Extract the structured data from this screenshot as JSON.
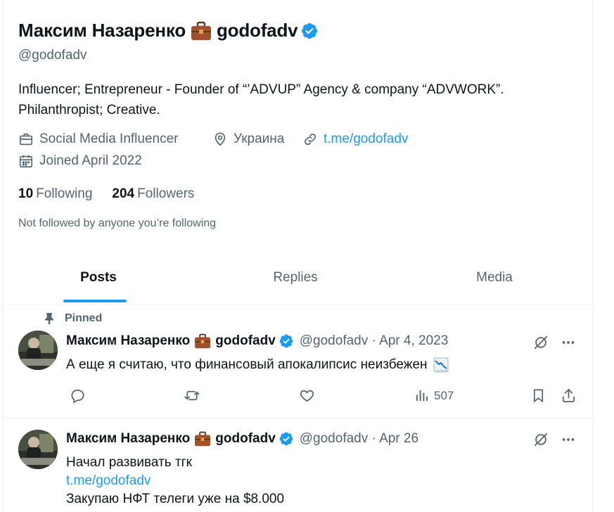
{
  "profile": {
    "name": "Максим Назаренко",
    "username": "godofadv",
    "handle": "@godofadv",
    "bio_line1": "Influencer; Entrepreneur - Founder of “’ADVUP” Agency & company “ADVWORK”.",
    "bio_line2": "Philanthropist; Creative.",
    "category": "Social Media Influencer",
    "location": "Украина",
    "website": "t.me/godofadv",
    "joined": "Joined April 2022",
    "following_count": "10",
    "following_label": "Following",
    "followers_count": "204",
    "followers_label": "Followers",
    "not_followed": "Not followed by anyone you’re following"
  },
  "tabs": [
    {
      "label": "Posts",
      "active": true
    },
    {
      "label": "Replies",
      "active": false
    },
    {
      "label": "Media",
      "active": false
    }
  ],
  "tweets": [
    {
      "pinned_label": "Pinned",
      "name": "Максим Назаренко",
      "username": "godofadv",
      "meta": "@godofadv · Apr 4, 2023",
      "text": "А еще я считаю, что финансовый апокалипсис неизбежен",
      "views": "507"
    },
    {
      "name": "Максим Назаренко",
      "username": "godofadv",
      "meta": "@godofadv · Apr 26",
      "line1": "Начал развивать тгк",
      "line2": "t.me/godofadv",
      "line3": "Закупаю НФТ телеги уже на $8.000"
    }
  ],
  "icons": {
    "verified": "verified-badge-icon",
    "briefcase": "briefcase-emoji-icon",
    "chart_down": "chart-decreasing-emoji-icon"
  },
  "colors": {
    "accent": "#1d9bf0",
    "secondary_text": "#536471",
    "primary_text": "#0f1419",
    "briefcase": "#a0522d"
  }
}
